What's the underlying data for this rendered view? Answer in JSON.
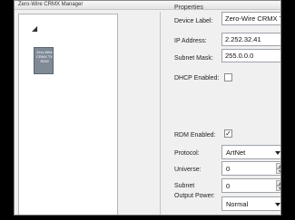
{
  "window": {
    "title": "Zero-Wire CRMX Manager"
  },
  "tree": {
    "collapse_glyph": "◢",
    "device_node": {
      "label": "Zero-Wire CRMX TX RDM"
    }
  },
  "properties": {
    "section_title": "Properties",
    "device_label": {
      "label": "Device Label:",
      "value": "Zero-Wire CRMX TX RDM"
    },
    "ip_address": {
      "label": "IP Address:",
      "value": "2.252.32.41"
    },
    "subnet_mask": {
      "label": "Subnet Mask:",
      "value": "255.0.0.0"
    },
    "dhcp": {
      "label": "DHCP Enabled:",
      "checked": false,
      "mark": ""
    },
    "rdm": {
      "label": "RDM Enabled:",
      "checked": true,
      "mark": "✓"
    },
    "protocol": {
      "label": "Protocol:",
      "value": "ArtNet"
    },
    "universe": {
      "label": "Universe:",
      "value": "0"
    },
    "subnet": {
      "label": "Subnet",
      "value": "0"
    },
    "output_power": {
      "label": "Output Power:",
      "value": "Normal"
    }
  }
}
